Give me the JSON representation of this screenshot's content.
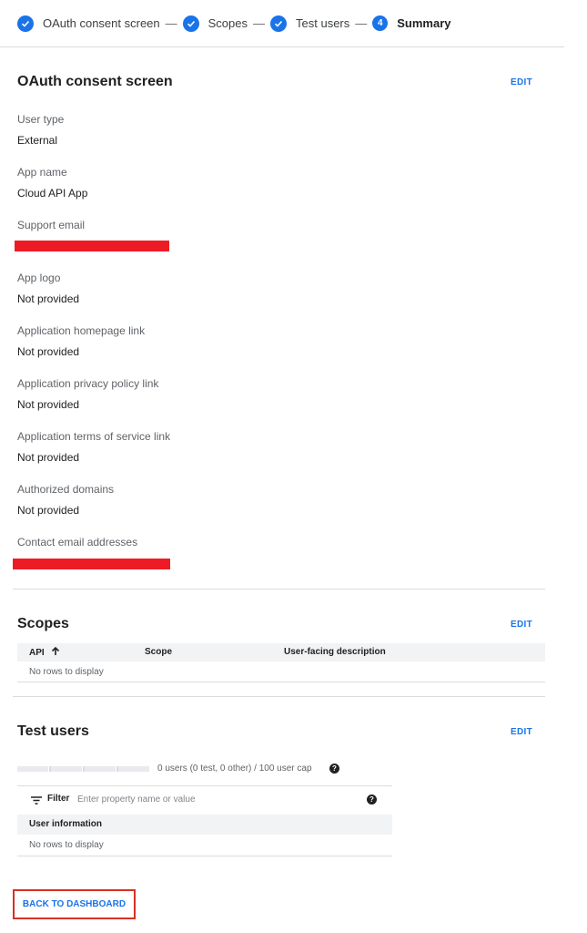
{
  "stepper": {
    "steps": [
      {
        "label": "OAuth consent screen",
        "state": "done"
      },
      {
        "label": "Scopes",
        "state": "done"
      },
      {
        "label": "Test users",
        "state": "done"
      },
      {
        "label": "Summary",
        "state": "current",
        "number": "4"
      }
    ],
    "separator": "—",
    "icons": {
      "done": "check-circle-icon"
    }
  },
  "consent": {
    "title": "OAuth consent screen",
    "edit_label": "EDIT",
    "fields": [
      {
        "label": "User type",
        "value": "External"
      },
      {
        "label": "App name",
        "value": "Cloud API App"
      },
      {
        "label": "Support email",
        "value": "",
        "redacted": true
      },
      {
        "label": "App logo",
        "value": "Not provided"
      },
      {
        "label": "Application homepage link",
        "value": "Not provided"
      },
      {
        "label": "Application privacy policy link",
        "value": "Not provided"
      },
      {
        "label": "Application terms of service link",
        "value": "Not provided"
      },
      {
        "label": "Authorized domains",
        "value": "Not provided"
      },
      {
        "label": "Contact email addresses",
        "value": "",
        "redacted": true
      }
    ]
  },
  "scopes": {
    "title": "Scopes",
    "edit_label": "EDIT",
    "columns": [
      "API",
      "Scope",
      "User-facing description"
    ],
    "sort_icon": "arrow-up-icon",
    "empty_text": "No rows to display"
  },
  "test_users": {
    "title": "Test users",
    "edit_label": "EDIT",
    "cap_text": "0 users (0 test, 0 other) / 100 user cap",
    "usage_fraction": 0,
    "filter_label": "Filter",
    "filter_placeholder": "Enter property name or value",
    "filter_value": "",
    "column": "User information",
    "empty_text": "No rows to display"
  },
  "footer": {
    "back_label": "BACK TO DASHBOARD"
  },
  "colors": {
    "accent": "#1a73e8",
    "redaction": "#ed1c24",
    "highlight_border": "#d93025"
  }
}
